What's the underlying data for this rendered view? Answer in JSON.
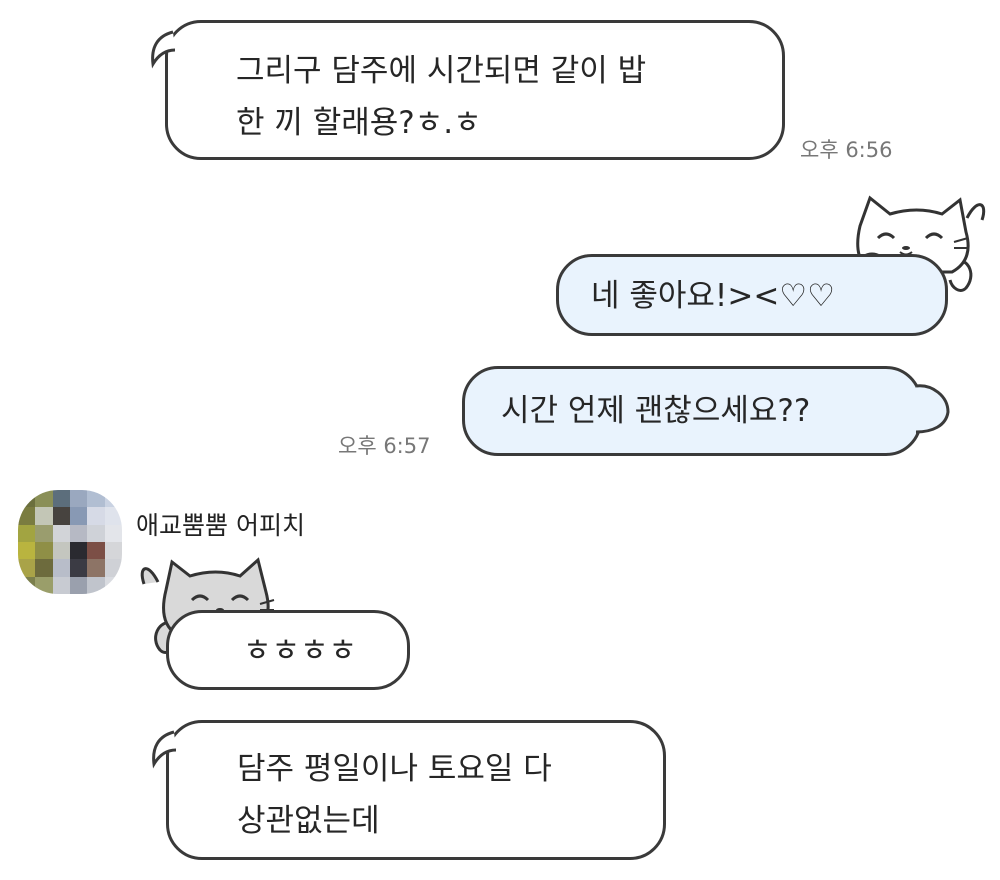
{
  "messages": [
    {
      "id": "m1",
      "direction": "in",
      "text": "그리구 담주에 시간되면 같이 밥\n한 끼 할래용?ㅎ.ㅎ",
      "time": "오후 6:56"
    },
    {
      "id": "m2",
      "direction": "out",
      "text": "네 좋아요!><♡♡"
    },
    {
      "id": "m3",
      "direction": "out",
      "text": "시간 언제 괜찮으세요??",
      "time": "오후 6:57"
    },
    {
      "id": "m4",
      "direction": "in",
      "text": "ㅎㅎㅎㅎ"
    },
    {
      "id": "m5",
      "direction": "in",
      "text": "담주 평일이나 토요일 다\n상관없는데"
    }
  ],
  "sender": {
    "name": "애교뿜뿜 어피치"
  },
  "colors": {
    "outgoing_bubble": "#e9f3fd",
    "incoming_bubble": "#ffffff",
    "bubble_border": "#3a3a3a",
    "cat_gray": "#d9d9d9"
  },
  "icons": {
    "sticker_cat_outgoing": "white-cat-peeking-icon",
    "sticker_cat_incoming": "gray-cat-peeking-icon",
    "avatar": "pixelated-avatar"
  }
}
